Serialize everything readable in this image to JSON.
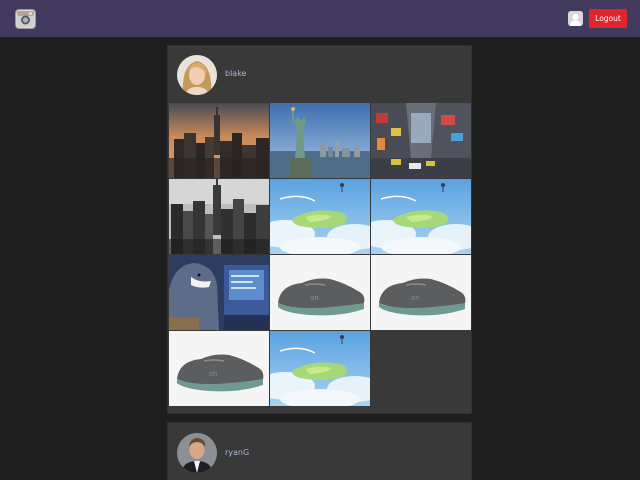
{
  "app": {
    "logo_icon": "camera-icon",
    "user_icon": "user-icon",
    "logout_label": "Logout",
    "accent_color": "#e0242c",
    "header_color": "#413a5e"
  },
  "feed": {
    "posts": [
      {
        "username": "blake",
        "avatar": "blonde-woman-avatar",
        "photos": [
          "nyc-skyline-sunset",
          "statue-of-liberty",
          "times-square",
          "nyc-black-and-white",
          "anime-sky-island",
          "anime-sky-island",
          "shark-costume-computer",
          "gray-running-shoe",
          "gray-running-shoe",
          "gray-running-shoe",
          "anime-sky-island"
        ]
      },
      {
        "username": "ryanG",
        "avatar": "man-in-suit-avatar",
        "photos": []
      }
    ]
  }
}
